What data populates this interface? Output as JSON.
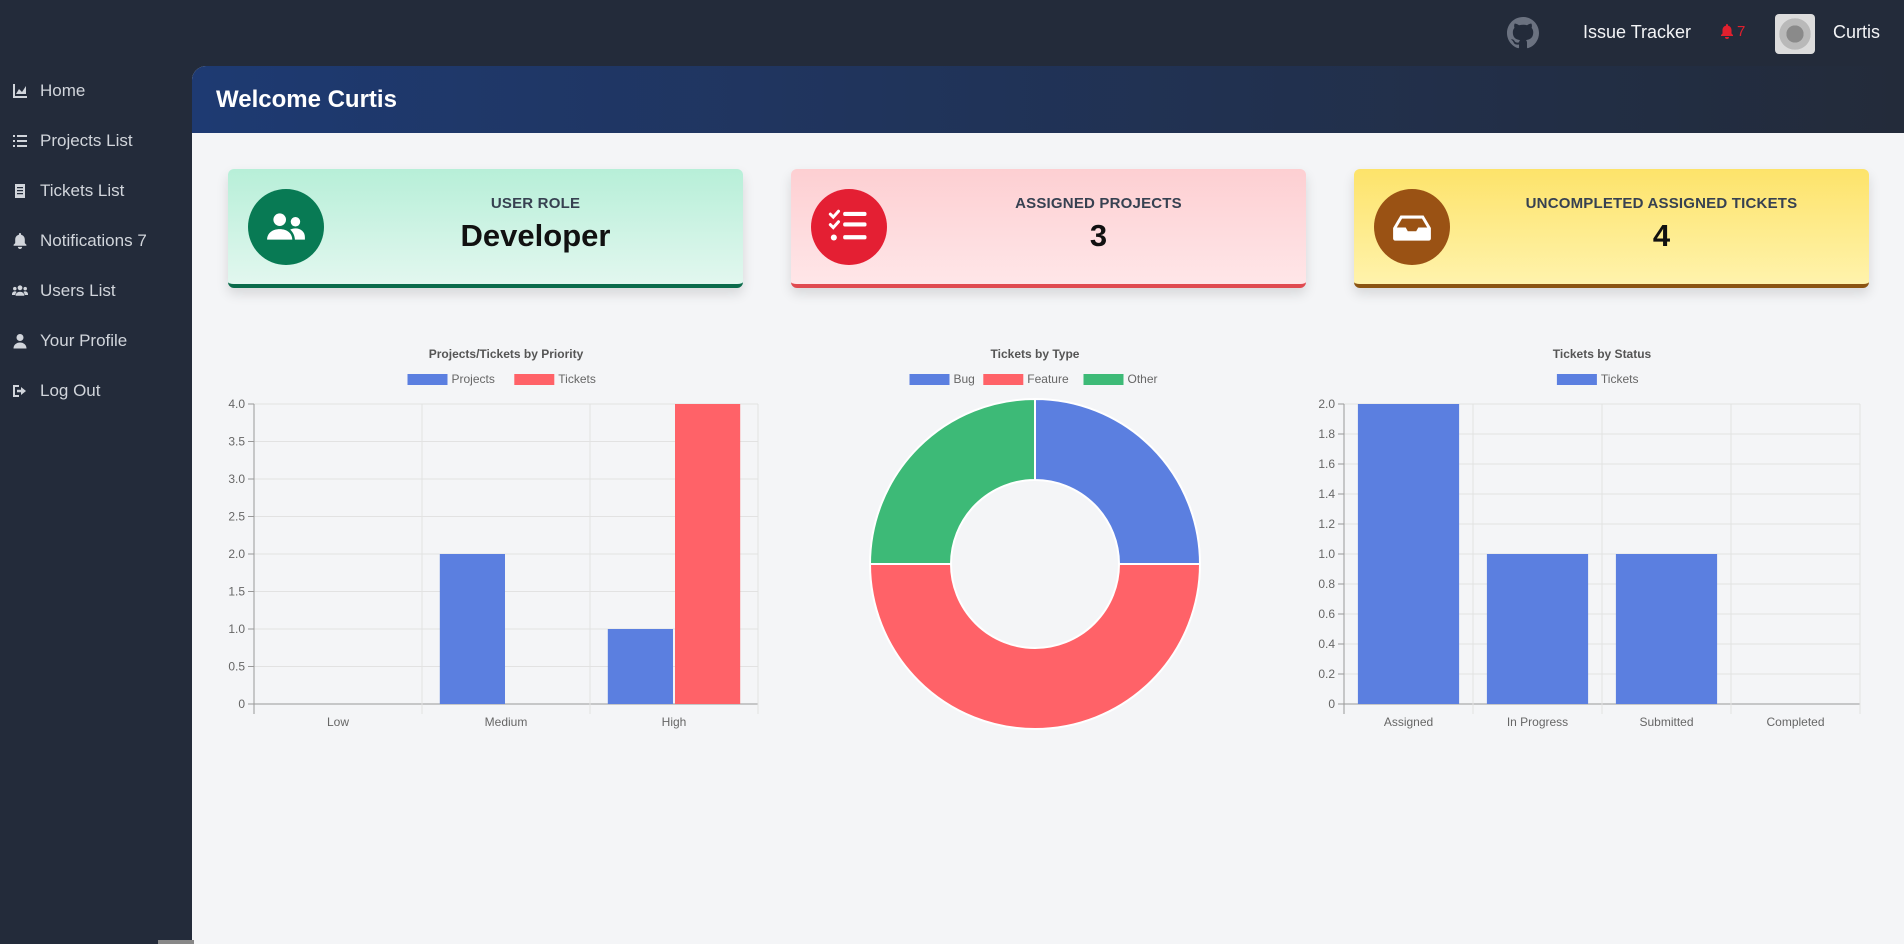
{
  "topnav": {
    "github_icon": "github-icon",
    "app_title": "Issue Tracker",
    "notification_count": "7",
    "user_name": "Curtis"
  },
  "sidebar": {
    "items": [
      {
        "label": "Home",
        "icon": "chart-area-icon"
      },
      {
        "label": "Projects List",
        "icon": "list-icon"
      },
      {
        "label": "Tickets List",
        "icon": "file-list-icon"
      },
      {
        "label": "Notifications 7",
        "icon": "bell-icon"
      },
      {
        "label": "Users List",
        "icon": "users-icon"
      },
      {
        "label": "Your Profile",
        "icon": "user-icon"
      },
      {
        "label": "Log Out",
        "icon": "sign-out-icon"
      }
    ]
  },
  "main": {
    "welcome": "Welcome Curtis",
    "cards": [
      {
        "label": "USER ROLE",
        "value": "Developer",
        "icon": "users-icon"
      },
      {
        "label": "ASSIGNED PROJECTS",
        "value": "3",
        "icon": "tasks-icon"
      },
      {
        "label": "UNCOMPLETED ASSIGNED TICKETS",
        "value": "4",
        "icon": "inbox-icon"
      }
    ]
  },
  "colors": {
    "blue": "#5b7fe0",
    "red": "#ff6268",
    "green": "#3dba77",
    "sidebar_bg": "#232b3a"
  },
  "chart_data": [
    {
      "type": "bar",
      "title": "Projects/Tickets by Priority",
      "categories": [
        "Low",
        "Medium",
        "High"
      ],
      "series": [
        {
          "name": "Projects",
          "values": [
            0,
            2,
            1
          ],
          "color": "#5b7fe0"
        },
        {
          "name": "Tickets",
          "values": [
            0,
            0,
            4
          ],
          "color": "#ff6268"
        }
      ],
      "ylim": [
        0,
        4
      ],
      "yticks": [
        "0",
        "0.5",
        "1.0",
        "1.5",
        "2.0",
        "2.5",
        "3.0",
        "3.5",
        "4.0"
      ],
      "legend": "top",
      "grid": true
    },
    {
      "type": "pie",
      "title": "Tickets by Type",
      "categories": [
        "Bug",
        "Feature",
        "Other"
      ],
      "values": [
        1,
        2,
        1
      ],
      "colors": [
        "#5b7fe0",
        "#ff6268",
        "#3dba77"
      ],
      "legend": "top"
    },
    {
      "type": "bar",
      "title": "Tickets by Status",
      "categories": [
        "Assigned",
        "In Progress",
        "Submitted",
        "Completed"
      ],
      "series": [
        {
          "name": "Tickets",
          "values": [
            2,
            1,
            1,
            0
          ],
          "color": "#5b7fe0"
        }
      ],
      "ylim": [
        0,
        2
      ],
      "yticks": [
        "0",
        "0.2",
        "0.4",
        "0.6",
        "0.8",
        "1.0",
        "1.2",
        "1.4",
        "1.6",
        "1.8",
        "2.0"
      ],
      "legend": "top",
      "grid": true
    }
  ]
}
